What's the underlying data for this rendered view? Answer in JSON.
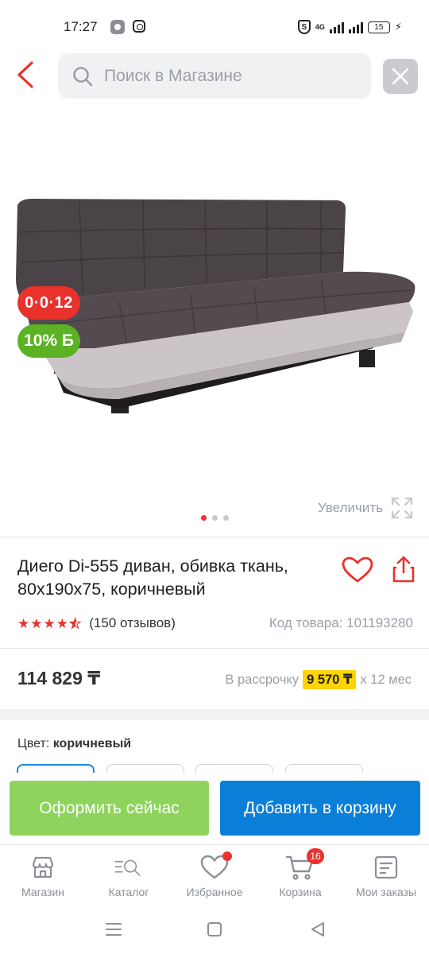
{
  "status_bar": {
    "time": "17:27",
    "network": "4G",
    "battery": "15"
  },
  "header": {
    "search_placeholder": "Поиск в Магазине"
  },
  "gallery": {
    "badge_timer": "0·0·12",
    "badge_bonus": "10% Б",
    "zoom_label": "Увеличить",
    "slide_count": 3,
    "active_slide": 1
  },
  "product": {
    "title": "Диего Di-555 диван, обивка ткань, 80x190x75, коричневый",
    "rating": 4.5,
    "reviews": "(150 отзывов)",
    "sku": "Код товара: 101193280",
    "price": "114 829 ₸",
    "installment_prefix": "В рассрочку",
    "installment_amount": "9 570 ₸",
    "installment_suffix": "x 12 мес",
    "color_label": "Цвет:",
    "color_value": "коричневый"
  },
  "actions": {
    "checkout_label": "Оформить сейчас",
    "add_to_cart_label": "Добавить в корзину"
  },
  "bottom_nav": {
    "items": [
      {
        "label": "Магазин",
        "icon": "store-icon"
      },
      {
        "label": "Каталог",
        "icon": "catalog-search-icon"
      },
      {
        "label": "Избранное",
        "icon": "heart-icon"
      },
      {
        "label": "Корзина",
        "icon": "cart-icon",
        "badge": "16"
      },
      {
        "label": "Мои заказы",
        "icon": "orders-icon"
      }
    ]
  },
  "colors": {
    "accent_red": "#e9322c",
    "checkout_green": "#8ed45c",
    "cart_blue": "#0a7fd8",
    "bonus_green": "#5bb324",
    "installment_yellow": "#ffd400"
  }
}
